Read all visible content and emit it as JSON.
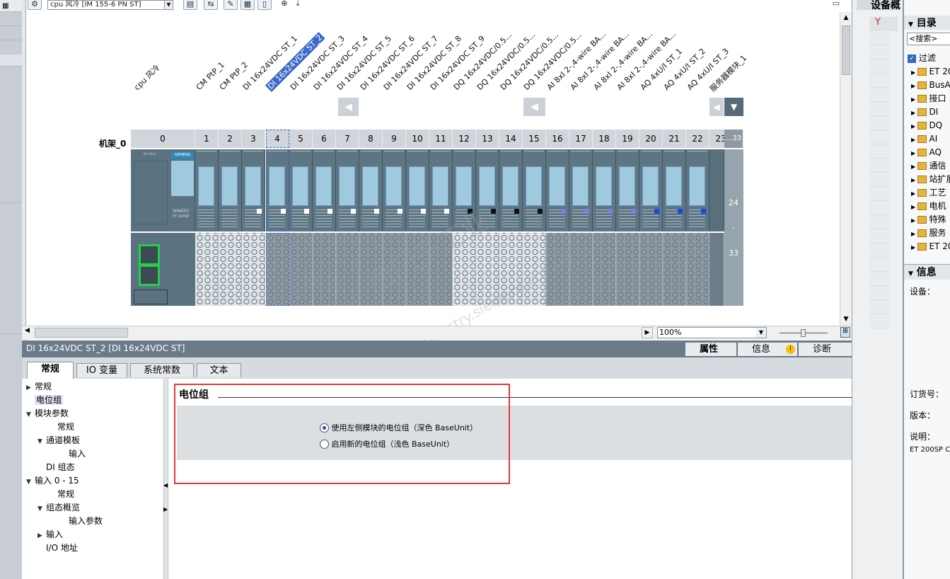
{
  "toolbar": {
    "device_select": "cpu 风冷 [IM 155-6 PN ST]",
    "zoom_in_icon": "zoom-in-icon"
  },
  "device_labels": [
    "cpu 风冷",
    "CM PtP_1",
    "CM PtP_2",
    "DI 16x24VDC ST_1",
    "DI 16x24VDC ST_2",
    "DI 16x24VDC ST_3",
    "DI 16x24VDC ST_4",
    "DI 16x24VDC ST_5",
    "DI 16x24VDC ST_6",
    "DI 16x24VDC ST_7",
    "DI 16x24VDC ST_8",
    "DI 16x24VDC ST_9",
    "DQ 16x24VDC/0.5...",
    "DQ 16x24VDC/0.5...",
    "DQ 16x24VDC/0.5...",
    "DQ 16x24VDC/0.5...",
    "AI 8xI 2-,4-wire BA...",
    "AI 8xI 2-,4-wire BA...",
    "AI 8xI 2-,4-wire BA...",
    "AI 8xI 2-,4-wire BA...",
    "AQ 4xU/I ST_1",
    "AQ 4xU/I ST_2",
    "AQ 4xU/I ST_3",
    "服务器模块_1"
  ],
  "slots": [
    "0",
    "1",
    "2",
    "3",
    "4",
    "5",
    "6",
    "7",
    "8",
    "9",
    "10",
    "11",
    "12",
    "13",
    "14",
    "15",
    "16",
    "17",
    "18",
    "19",
    "20",
    "21",
    "22",
    "23",
    "...33"
  ],
  "rack_label": "机架_0",
  "range_labels": {
    "start": "24",
    "dash": "-",
    "end": "33"
  },
  "siemens": "SIEMENS",
  "simatic": "SIMATIC",
  "et200": "ET 200SP",
  "zoom": "100%",
  "properties": {
    "title": "DI 16x24VDC ST_2 [DI 16x24VDC ST]",
    "header_tabs": [
      "属性",
      "信息",
      "诊断"
    ],
    "tabs": [
      "常规",
      "IO 变量",
      "系统常数",
      "文本"
    ]
  },
  "tree": [
    {
      "label": "常规",
      "arrow": "▶",
      "indent": 0
    },
    {
      "label": "电位组",
      "arrow": "",
      "indent": 0,
      "selected": true
    },
    {
      "label": "模块参数",
      "arrow": "▼",
      "indent": 0
    },
    {
      "label": "常规",
      "arrow": "",
      "indent": 2
    },
    {
      "label": "通道模板",
      "arrow": "▼",
      "indent": 1
    },
    {
      "label": "输入",
      "arrow": "",
      "indent": 3
    },
    {
      "label": "DI 组态",
      "arrow": "",
      "indent": 1
    },
    {
      "label": "输入 0 - 15",
      "arrow": "▼",
      "indent": 0
    },
    {
      "label": "常规",
      "arrow": "",
      "indent": 2
    },
    {
      "label": "组态概览",
      "arrow": "▼",
      "indent": 1
    },
    {
      "label": "输入参数",
      "arrow": "",
      "indent": 3
    },
    {
      "label": "输入",
      "arrow": "▶",
      "indent": 1
    },
    {
      "label": "I/O 地址",
      "arrow": "",
      "indent": 1
    }
  ],
  "section": {
    "title": "电位组",
    "options": [
      {
        "label": "使用左侧模块的电位组（深色 BaseUnit）",
        "checked": true
      },
      {
        "label": "启用新的电位组（浅色 BaseUnit）",
        "checked": false
      }
    ]
  },
  "right_panel": {
    "title": "设备概",
    "catalog": "目录",
    "search": "<搜索>",
    "filter": "过滤",
    "items": [
      "ET 20",
      "BusA",
      "接口",
      "DI",
      "DQ",
      "AI",
      "AQ",
      "通信",
      "站扩展",
      "工艺",
      "电机",
      "特殊",
      "服务",
      "ET 20"
    ],
    "info": "信息",
    "device": "设备：",
    "order_no": "订货号：",
    "version": "版本：",
    "desc": "说明：",
    "desc_val": "ET 200SP C"
  },
  "watermark": {
    "line1": "西门子工业",
    "line2": "support.industry.siemens.com/cs"
  }
}
